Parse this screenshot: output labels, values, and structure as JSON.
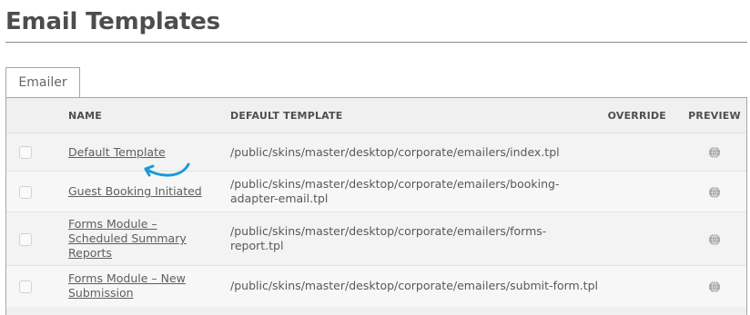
{
  "page": {
    "title": "Email Templates"
  },
  "tabs": [
    {
      "label": "Emailer",
      "active": true
    }
  ],
  "table": {
    "columns": {
      "name": "NAME",
      "default_template": "DEFAULT TEMPLATE",
      "override": "OVERRIDE",
      "preview": "PREVIEW"
    },
    "rows": [
      {
        "name": "Default Template",
        "path_line1": "/public/skins/master/desktop/corporate/emailers/index.tpl",
        "path_line2": "",
        "override": "",
        "preview_icon": "globe-icon"
      },
      {
        "name": "Guest Booking Initiated",
        "path_line1": "/public/skins/master/desktop/corporate/emailers/booking-",
        "path_line2": "adapter-email.tpl",
        "override": "",
        "preview_icon": "globe-icon"
      },
      {
        "name_line1": "Forms Module –",
        "name_line2": "Scheduled Summary",
        "name_line3": "Reports",
        "path_line1": "/public/skins/master/desktop/corporate/emailers/forms-",
        "path_line2": "report.tpl",
        "override": "",
        "preview_icon": "globe-icon"
      },
      {
        "name_line1": "Forms Module – New",
        "name_line2": "Submission",
        "path_line1": "/public/skins/master/desktop/corporate/emailers/submit-form.tpl",
        "path_line2": "",
        "override": "",
        "preview_icon": "globe-icon"
      }
    ]
  },
  "colors": {
    "annotation_arrow": "#1a9bd7",
    "header_bg": "#f0f0f0",
    "row_bg_odd": "#f3f3f3",
    "row_bg_even": "#f7f7f7",
    "text": "#595959"
  }
}
